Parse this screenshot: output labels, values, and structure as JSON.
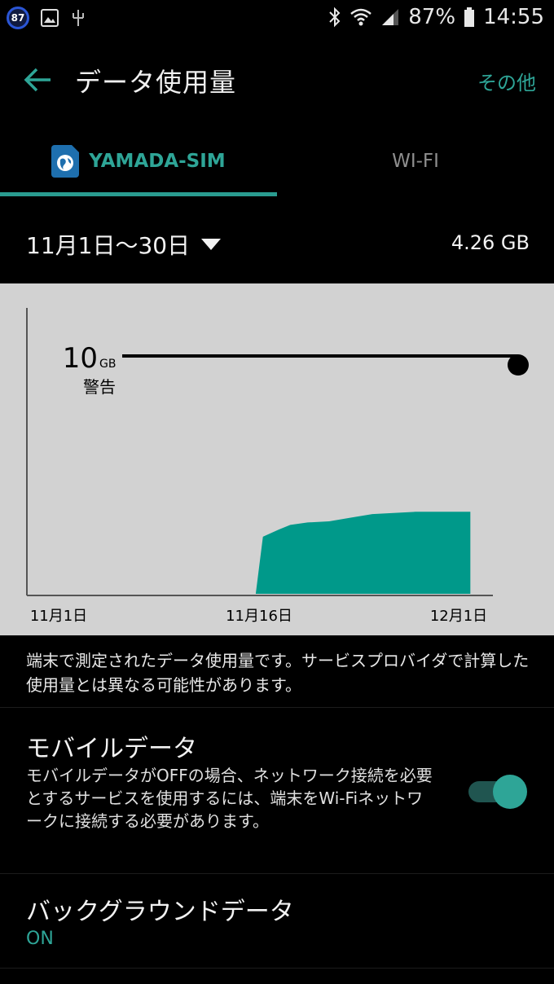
{
  "status": {
    "notif_count": "87",
    "battery_pct": "87%",
    "time": "14:55",
    "icons": [
      "image-icon",
      "usb-icon",
      "bluetooth-icon",
      "wifi-icon",
      "signal-icon",
      "battery-icon"
    ]
  },
  "appbar": {
    "title": "データ使用量",
    "more": "その他"
  },
  "tabs": [
    {
      "label": "YAMADA-SIM",
      "active": true
    },
    {
      "label": "WI-FI",
      "active": false
    }
  ],
  "period": {
    "label": "11月1日〜30日",
    "total": "4.26 GB"
  },
  "chart_data": {
    "type": "area",
    "warning_value": "10",
    "warning_unit": "GB",
    "warning_label": "警告",
    "x_ticks": [
      "11月1日",
      "11月16日",
      "12月1日"
    ],
    "points": [
      {
        "day": 16.2,
        "gb": 0.0
      },
      {
        "day": 16.9,
        "gb": 0.0
      },
      {
        "day": 17.4,
        "gb": 2.4
      },
      {
        "day": 18.5,
        "gb": 2.7
      },
      {
        "day": 19.3,
        "gb": 2.9
      },
      {
        "day": 20.5,
        "gb": 3.0
      },
      {
        "day": 22.0,
        "gb": 3.05
      },
      {
        "day": 23.5,
        "gb": 3.2
      },
      {
        "day": 25.0,
        "gb": 3.35
      },
      {
        "day": 28.0,
        "gb": 3.45
      },
      {
        "day": 30.0,
        "gb": 3.45
      }
    ],
    "colors": {
      "fill": "#00998a",
      "warning_line": "#000000",
      "background": "#d2d2d2"
    }
  },
  "note": "端末で測定されたデータ使用量です。サービスプロバイダで計算した使用量とは異なる可能性があります。",
  "mobile_data": {
    "title": "モバイルデータ",
    "description": "モバイルデータがOFFの場合、ネットワーク接続を必要とするサービスを使用するには、端末をWi-Fiネットワークに接続する必要があります。",
    "enabled": true
  },
  "background_data": {
    "title": "バックグラウンドデータ",
    "value": "ON"
  },
  "accent": "#2ea597"
}
